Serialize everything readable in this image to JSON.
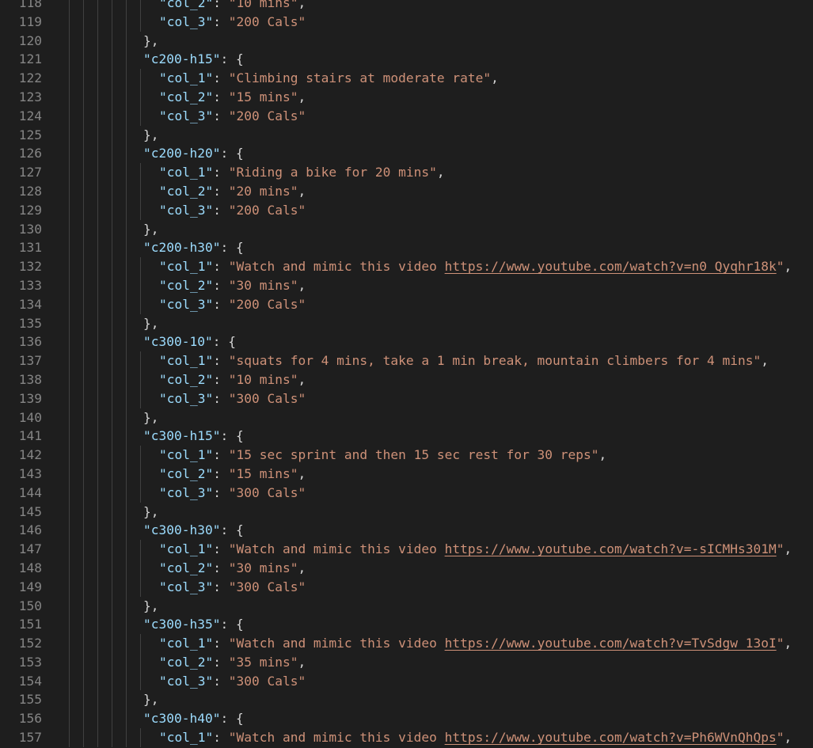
{
  "editor": {
    "colors": {
      "background": "#1e1e1e",
      "line_number": "#858585",
      "key": "#9cdcfe",
      "string": "#ce9178",
      "punctuation": "#d4d4d4",
      "indent_guide": "#404040"
    },
    "lines": [
      {
        "num": "118",
        "indent": 1,
        "parts": [
          {
            "t": "k",
            "v": "\"col_2\""
          },
          {
            "t": "p",
            "v": ": "
          },
          {
            "t": "s",
            "v": "\"10 mins\""
          },
          {
            "t": "p",
            "v": ","
          }
        ]
      },
      {
        "num": "119",
        "indent": 1,
        "parts": [
          {
            "t": "k",
            "v": "\"col_3\""
          },
          {
            "t": "p",
            "v": ": "
          },
          {
            "t": "s",
            "v": "\"200 Cals\""
          }
        ]
      },
      {
        "num": "120",
        "indent": 0,
        "parts": [
          {
            "t": "p",
            "v": "},"
          }
        ]
      },
      {
        "num": "121",
        "indent": 0,
        "parts": [
          {
            "t": "k",
            "v": "\"c200-h15\""
          },
          {
            "t": "p",
            "v": ": {"
          }
        ]
      },
      {
        "num": "122",
        "indent": 1,
        "parts": [
          {
            "t": "k",
            "v": "\"col_1\""
          },
          {
            "t": "p",
            "v": ": "
          },
          {
            "t": "s",
            "v": "\"Climbing stairs at moderate rate\""
          },
          {
            "t": "p",
            "v": ","
          }
        ]
      },
      {
        "num": "123",
        "indent": 1,
        "parts": [
          {
            "t": "k",
            "v": "\"col_2\""
          },
          {
            "t": "p",
            "v": ": "
          },
          {
            "t": "s",
            "v": "\"15 mins\""
          },
          {
            "t": "p",
            "v": ","
          }
        ]
      },
      {
        "num": "124",
        "indent": 1,
        "parts": [
          {
            "t": "k",
            "v": "\"col_3\""
          },
          {
            "t": "p",
            "v": ": "
          },
          {
            "t": "s",
            "v": "\"200 Cals\""
          }
        ]
      },
      {
        "num": "125",
        "indent": 0,
        "parts": [
          {
            "t": "p",
            "v": "},"
          }
        ]
      },
      {
        "num": "126",
        "indent": 0,
        "parts": [
          {
            "t": "k",
            "v": "\"c200-h20\""
          },
          {
            "t": "p",
            "v": ": {"
          }
        ]
      },
      {
        "num": "127",
        "indent": 1,
        "parts": [
          {
            "t": "k",
            "v": "\"col_1\""
          },
          {
            "t": "p",
            "v": ": "
          },
          {
            "t": "s",
            "v": "\"Riding a bike for 20 mins\""
          },
          {
            "t": "p",
            "v": ","
          }
        ]
      },
      {
        "num": "128",
        "indent": 1,
        "parts": [
          {
            "t": "k",
            "v": "\"col_2\""
          },
          {
            "t": "p",
            "v": ": "
          },
          {
            "t": "s",
            "v": "\"20 mins\""
          },
          {
            "t": "p",
            "v": ","
          }
        ]
      },
      {
        "num": "129",
        "indent": 1,
        "parts": [
          {
            "t": "k",
            "v": "\"col_3\""
          },
          {
            "t": "p",
            "v": ": "
          },
          {
            "t": "s",
            "v": "\"200 Cals\""
          }
        ]
      },
      {
        "num": "130",
        "indent": 0,
        "parts": [
          {
            "t": "p",
            "v": "},"
          }
        ]
      },
      {
        "num": "131",
        "indent": 0,
        "parts": [
          {
            "t": "k",
            "v": "\"c200-h30\""
          },
          {
            "t": "p",
            "v": ": {"
          }
        ]
      },
      {
        "num": "132",
        "indent": 1,
        "parts": [
          {
            "t": "k",
            "v": "\"col_1\""
          },
          {
            "t": "p",
            "v": ": "
          },
          {
            "t": "s",
            "v": "\"Watch and mimic this video "
          },
          {
            "t": "u",
            "v": "https://www.youtube.com/watch?v=n0_Qyqhr18k"
          },
          {
            "t": "s",
            "v": "\""
          },
          {
            "t": "p",
            "v": ","
          }
        ]
      },
      {
        "num": "133",
        "indent": 1,
        "parts": [
          {
            "t": "k",
            "v": "\"col_2\""
          },
          {
            "t": "p",
            "v": ": "
          },
          {
            "t": "s",
            "v": "\"30 mins\""
          },
          {
            "t": "p",
            "v": ","
          }
        ]
      },
      {
        "num": "134",
        "indent": 1,
        "parts": [
          {
            "t": "k",
            "v": "\"col_3\""
          },
          {
            "t": "p",
            "v": ": "
          },
          {
            "t": "s",
            "v": "\"200 Cals\""
          }
        ]
      },
      {
        "num": "135",
        "indent": 0,
        "parts": [
          {
            "t": "p",
            "v": "},"
          }
        ]
      },
      {
        "num": "136",
        "indent": 0,
        "parts": [
          {
            "t": "k",
            "v": "\"c300-10\""
          },
          {
            "t": "p",
            "v": ": {"
          }
        ]
      },
      {
        "num": "137",
        "indent": 1,
        "parts": [
          {
            "t": "k",
            "v": "\"col_1\""
          },
          {
            "t": "p",
            "v": ": "
          },
          {
            "t": "s",
            "v": "\"squats for 4 mins, take a 1 min break, mountain climbers for 4 mins\""
          },
          {
            "t": "p",
            "v": ","
          }
        ]
      },
      {
        "num": "138",
        "indent": 1,
        "parts": [
          {
            "t": "k",
            "v": "\"col_2\""
          },
          {
            "t": "p",
            "v": ": "
          },
          {
            "t": "s",
            "v": "\"10 mins\""
          },
          {
            "t": "p",
            "v": ","
          }
        ]
      },
      {
        "num": "139",
        "indent": 1,
        "parts": [
          {
            "t": "k",
            "v": "\"col_3\""
          },
          {
            "t": "p",
            "v": ": "
          },
          {
            "t": "s",
            "v": "\"300 Cals\""
          }
        ]
      },
      {
        "num": "140",
        "indent": 0,
        "parts": [
          {
            "t": "p",
            "v": "},"
          }
        ]
      },
      {
        "num": "141",
        "indent": 0,
        "parts": [
          {
            "t": "k",
            "v": "\"c300-h15\""
          },
          {
            "t": "p",
            "v": ": {"
          }
        ]
      },
      {
        "num": "142",
        "indent": 1,
        "parts": [
          {
            "t": "k",
            "v": "\"col_1\""
          },
          {
            "t": "p",
            "v": ": "
          },
          {
            "t": "s",
            "v": "\"15 sec sprint and then 15 sec rest for 30 reps\""
          },
          {
            "t": "p",
            "v": ","
          }
        ]
      },
      {
        "num": "143",
        "indent": 1,
        "parts": [
          {
            "t": "k",
            "v": "\"col_2\""
          },
          {
            "t": "p",
            "v": ": "
          },
          {
            "t": "s",
            "v": "\"15 mins\""
          },
          {
            "t": "p",
            "v": ","
          }
        ]
      },
      {
        "num": "144",
        "indent": 1,
        "parts": [
          {
            "t": "k",
            "v": "\"col_3\""
          },
          {
            "t": "p",
            "v": ": "
          },
          {
            "t": "s",
            "v": "\"300 Cals\""
          }
        ]
      },
      {
        "num": "145",
        "indent": 0,
        "parts": [
          {
            "t": "p",
            "v": "},"
          }
        ]
      },
      {
        "num": "146",
        "indent": 0,
        "parts": [
          {
            "t": "k",
            "v": "\"c300-h30\""
          },
          {
            "t": "p",
            "v": ": {"
          }
        ]
      },
      {
        "num": "147",
        "indent": 1,
        "parts": [
          {
            "t": "k",
            "v": "\"col_1\""
          },
          {
            "t": "p",
            "v": ": "
          },
          {
            "t": "s",
            "v": "\"Watch and mimic this video "
          },
          {
            "t": "u",
            "v": "https://www.youtube.com/watch?v=-sICMHs301M"
          },
          {
            "t": "s",
            "v": "\""
          },
          {
            "t": "p",
            "v": ","
          }
        ]
      },
      {
        "num": "148",
        "indent": 1,
        "parts": [
          {
            "t": "k",
            "v": "\"col_2\""
          },
          {
            "t": "p",
            "v": ": "
          },
          {
            "t": "s",
            "v": "\"30 mins\""
          },
          {
            "t": "p",
            "v": ","
          }
        ]
      },
      {
        "num": "149",
        "indent": 1,
        "parts": [
          {
            "t": "k",
            "v": "\"col_3\""
          },
          {
            "t": "p",
            "v": ": "
          },
          {
            "t": "s",
            "v": "\"300 Cals\""
          }
        ]
      },
      {
        "num": "150",
        "indent": 0,
        "parts": [
          {
            "t": "p",
            "v": "},"
          }
        ]
      },
      {
        "num": "151",
        "indent": 0,
        "parts": [
          {
            "t": "k",
            "v": "\"c300-h35\""
          },
          {
            "t": "p",
            "v": ": {"
          }
        ]
      },
      {
        "num": "152",
        "indent": 1,
        "parts": [
          {
            "t": "k",
            "v": "\"col_1\""
          },
          {
            "t": "p",
            "v": ": "
          },
          {
            "t": "s",
            "v": "\"Watch and mimic this video "
          },
          {
            "t": "u",
            "v": "https://www.youtube.com/watch?v=TvSdgw_13oI"
          },
          {
            "t": "s",
            "v": "\""
          },
          {
            "t": "p",
            "v": ","
          }
        ]
      },
      {
        "num": "153",
        "indent": 1,
        "parts": [
          {
            "t": "k",
            "v": "\"col_2\""
          },
          {
            "t": "p",
            "v": ": "
          },
          {
            "t": "s",
            "v": "\"35 mins\""
          },
          {
            "t": "p",
            "v": ","
          }
        ]
      },
      {
        "num": "154",
        "indent": 1,
        "parts": [
          {
            "t": "k",
            "v": "\"col_3\""
          },
          {
            "t": "p",
            "v": ": "
          },
          {
            "t": "s",
            "v": "\"300 Cals\""
          }
        ]
      },
      {
        "num": "155",
        "indent": 0,
        "parts": [
          {
            "t": "p",
            "v": "},"
          }
        ]
      },
      {
        "num": "156",
        "indent": 0,
        "parts": [
          {
            "t": "k",
            "v": "\"c300-h40\""
          },
          {
            "t": "p",
            "v": ": {"
          }
        ]
      },
      {
        "num": "157",
        "indent": 1,
        "parts": [
          {
            "t": "k",
            "v": "\"col_1\""
          },
          {
            "t": "p",
            "v": ": "
          },
          {
            "t": "s",
            "v": "\"Watch and mimic this video "
          },
          {
            "t": "u",
            "v": "https://www.youtube.com/watch?v=Ph6WVnQhQps"
          },
          {
            "t": "s",
            "v": "\""
          },
          {
            "t": "p",
            "v": ","
          }
        ]
      }
    ]
  }
}
